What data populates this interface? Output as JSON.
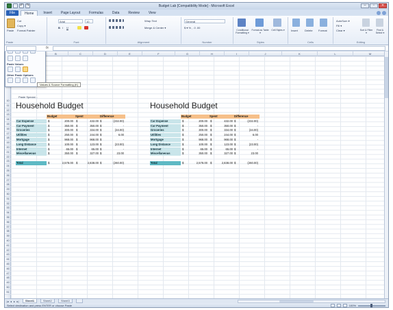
{
  "window": {
    "title": "Budget Lab [Compatibility Mode] - Microsoft Excel",
    "qat_icons": [
      "excel-icon",
      "save-icon",
      "undo-icon",
      "redo-icon"
    ],
    "controls": [
      "–",
      "▫",
      "✕"
    ]
  },
  "tabs": [
    "File",
    "Home",
    "Insert",
    "Page Layout",
    "Formulas",
    "Data",
    "Review",
    "View"
  ],
  "active_tab": "Home",
  "ribbon": {
    "clipboard": {
      "paste": "Paste",
      "cut": "Cut",
      "copy": "Copy ▾",
      "format_painter": "Format Painter",
      "label": "Paste"
    },
    "font": {
      "name": "Arial",
      "size": "10",
      "label": "Font"
    },
    "alignment": {
      "wrap": "Wrap Text",
      "merge": "Merge & Center ▾",
      "label": "Alignment"
    },
    "number": {
      "format": "General",
      "symbols": "$ ▾ % ,  .0 .00",
      "label": "Number"
    },
    "styles": {
      "conditional": "Conditional Formatting ▾",
      "format_table": "Format as Table ▾",
      "cell_styles": "Cell Styles ▾",
      "label": "Styles"
    },
    "cells": {
      "insert": "Insert",
      "delete": "Delete",
      "format": "Format",
      "label": "Cells"
    },
    "editing": {
      "autosum": "AutoSum ▾",
      "fill": "Fill ▾",
      "clear": "Clear ▾",
      "sort": "Sort & Filter ▾",
      "find": "Find & Select ▾",
      "label": "Editing"
    }
  },
  "formula_bar": {
    "fx": "fx",
    "value": ""
  },
  "columns": [
    "A",
    "B",
    "C",
    "D",
    "E",
    "F",
    "G",
    "H",
    "I",
    "J",
    "K",
    "L",
    "M",
    "N"
  ],
  "rows": [
    "10",
    "11",
    "12",
    "13",
    "14",
    "15",
    "16",
    "17",
    "18",
    "19",
    "20",
    "21",
    "22",
    "23",
    "24",
    "25",
    "26",
    "27",
    "28",
    "29",
    "30",
    "31",
    "32",
    "33",
    "34",
    "35",
    "36",
    "37",
    "38",
    "39",
    "40",
    "41",
    "42",
    "43",
    "44",
    "45",
    "46",
    "47",
    "48",
    "49",
    "50",
    "51"
  ],
  "paste_popup": {
    "section_paste_values": "Paste Values",
    "section_other": "Other Paste Options",
    "special": "Paste Special...",
    "tooltip": "Values & Source Formatting (K)"
  },
  "sheet_title": "Household Budget",
  "budget_table": {
    "headers": [
      "Budget",
      "Spent",
      "Difference"
    ],
    "currency": "$",
    "rows": [
      {
        "label": "Car Expense",
        "budget": "200.00",
        "spent": "432.00",
        "diff": "(232.00)"
      },
      {
        "label": "Car Payment",
        "budget": "350.00",
        "spent": "350.00",
        "diff": "-"
      },
      {
        "label": "Groceries",
        "budget": "300.00",
        "spent": "334.00",
        "diff": "(34.00)"
      },
      {
        "label": "Utilities",
        "budget": "250.00",
        "spent": "244.00",
        "diff": "6.00"
      },
      {
        "label": "Mortgage",
        "budget": "968.00",
        "spent": "968.00",
        "diff": "-"
      },
      {
        "label": "Long Distance",
        "budget": "100.00",
        "spent": "123.00",
        "diff": "(23.00)"
      },
      {
        "label": "Internet",
        "budget": "65.00",
        "spent": "65.00",
        "diff": "-"
      },
      {
        "label": "Miscellaneous",
        "budget": "350.00",
        "spent": "327.00",
        "diff": "23.00"
      }
    ],
    "total": {
      "label": "Total",
      "budget": "2,578.00",
      "spent": "2,838.00",
      "diff": "(260.00)"
    }
  },
  "sheet_tabs": [
    "Sheet1",
    "Sheet2",
    "Sheet3"
  ],
  "status": {
    "message": "Select destination and press ENTER or choose Paste",
    "zoom": "100%"
  }
}
